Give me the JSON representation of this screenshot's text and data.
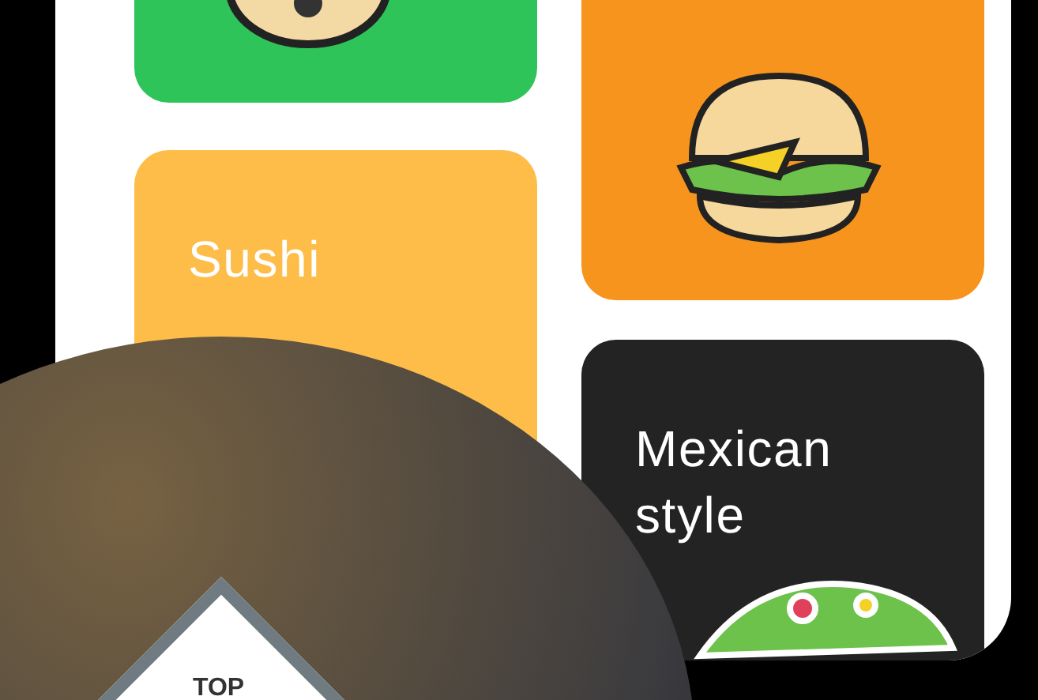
{
  "categories": [
    {
      "color": "#2fc45a",
      "kind": "face"
    },
    {
      "color": "#f7941d",
      "kind": "burger"
    },
    {
      "label": "Sushi",
      "color": "#fdbd48"
    },
    {
      "label": "Mexican style",
      "color": "#232323",
      "kind": "taco"
    }
  ],
  "badge": {
    "text": "TOP"
  }
}
